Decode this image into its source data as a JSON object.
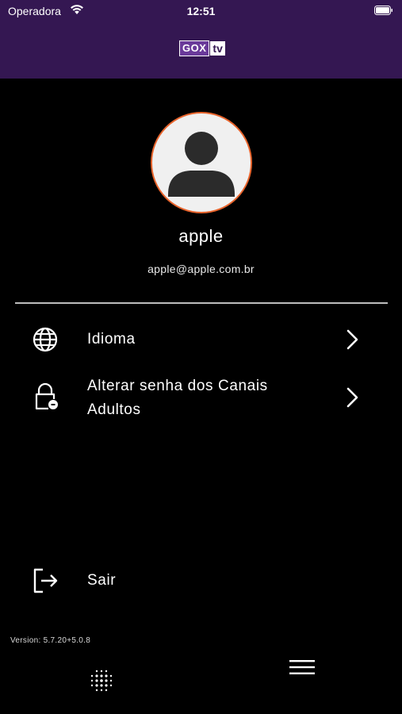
{
  "status_bar": {
    "carrier": "Operadora",
    "time": "12:51"
  },
  "header": {
    "logo_part1": "GOX",
    "logo_part2": "tv"
  },
  "profile": {
    "name": "apple",
    "email": "apple@apple.com.br"
  },
  "menu": {
    "language_label": "Idioma",
    "adult_password_label_line1": "Alterar senha dos Canais",
    "adult_password_label_line2": "Adultos",
    "logout_label": "Sair"
  },
  "footer": {
    "version": "Version: 5.7.20+5.0.8"
  },
  "colors": {
    "header_bg": "#341752",
    "avatar_border": "#e8642c",
    "background": "#000000"
  },
  "icons": {
    "wifi": "wifi-icon",
    "battery": "battery-icon",
    "avatar": "user-icon",
    "language": "globe-icon",
    "lock": "lock-icon",
    "chevron": "chevron-right-icon",
    "logout": "logout-icon",
    "dots": "dots-grid-icon",
    "menu": "hamburger-icon"
  }
}
